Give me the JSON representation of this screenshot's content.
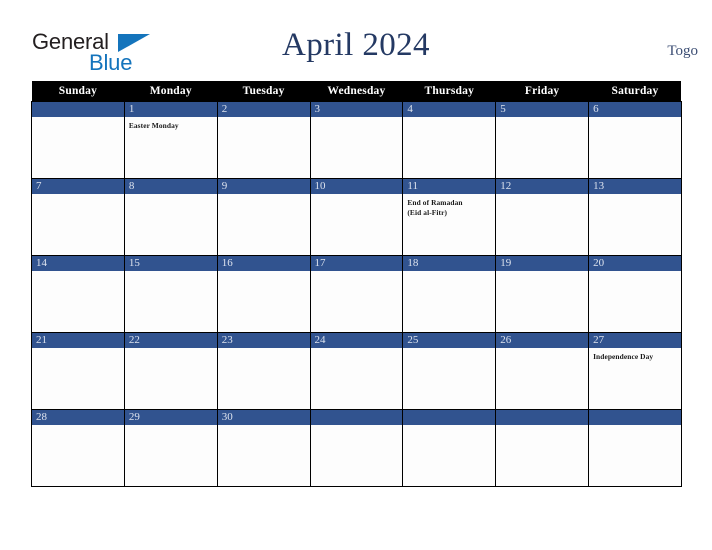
{
  "brand": {
    "name_part1": "General",
    "name_part2": "Blue",
    "triangle_icon": "triangle-icon",
    "colors": {
      "dark": "#231f20",
      "blue": "#1474bc"
    }
  },
  "header": {
    "title": "April 2024",
    "country": "Togo",
    "title_color": "#243963"
  },
  "calendar": {
    "month": "April",
    "year": "2024",
    "weekday_headers": [
      "Sunday",
      "Monday",
      "Tuesday",
      "Wednesday",
      "Thursday",
      "Friday",
      "Saturday"
    ],
    "colors": {
      "header_bg": "#000000",
      "header_text": "#ffffff",
      "daybar_bg": "#31538f",
      "daybar_text": "#dde3ee",
      "cell_bg": "#fdfdfd",
      "grid_line": "#000000"
    },
    "weeks": [
      [
        {
          "day": "",
          "events": []
        },
        {
          "day": "1",
          "events": [
            "Easter Monday"
          ]
        },
        {
          "day": "2",
          "events": []
        },
        {
          "day": "3",
          "events": []
        },
        {
          "day": "4",
          "events": []
        },
        {
          "day": "5",
          "events": []
        },
        {
          "day": "6",
          "events": []
        }
      ],
      [
        {
          "day": "7",
          "events": []
        },
        {
          "day": "8",
          "events": []
        },
        {
          "day": "9",
          "events": []
        },
        {
          "day": "10",
          "events": []
        },
        {
          "day": "11",
          "events": [
            "End of Ramadan",
            "(Eid al-Fitr)"
          ]
        },
        {
          "day": "12",
          "events": []
        },
        {
          "day": "13",
          "events": []
        }
      ],
      [
        {
          "day": "14",
          "events": []
        },
        {
          "day": "15",
          "events": []
        },
        {
          "day": "16",
          "events": []
        },
        {
          "day": "17",
          "events": []
        },
        {
          "day": "18",
          "events": []
        },
        {
          "day": "19",
          "events": []
        },
        {
          "day": "20",
          "events": []
        }
      ],
      [
        {
          "day": "21",
          "events": []
        },
        {
          "day": "22",
          "events": []
        },
        {
          "day": "23",
          "events": []
        },
        {
          "day": "24",
          "events": []
        },
        {
          "day": "25",
          "events": []
        },
        {
          "day": "26",
          "events": []
        },
        {
          "day": "27",
          "events": [
            "Independence Day"
          ]
        }
      ],
      [
        {
          "day": "28",
          "events": []
        },
        {
          "day": "29",
          "events": []
        },
        {
          "day": "30",
          "events": []
        },
        {
          "day": "",
          "events": []
        },
        {
          "day": "",
          "events": []
        },
        {
          "day": "",
          "events": []
        },
        {
          "day": "",
          "events": []
        }
      ]
    ]
  }
}
